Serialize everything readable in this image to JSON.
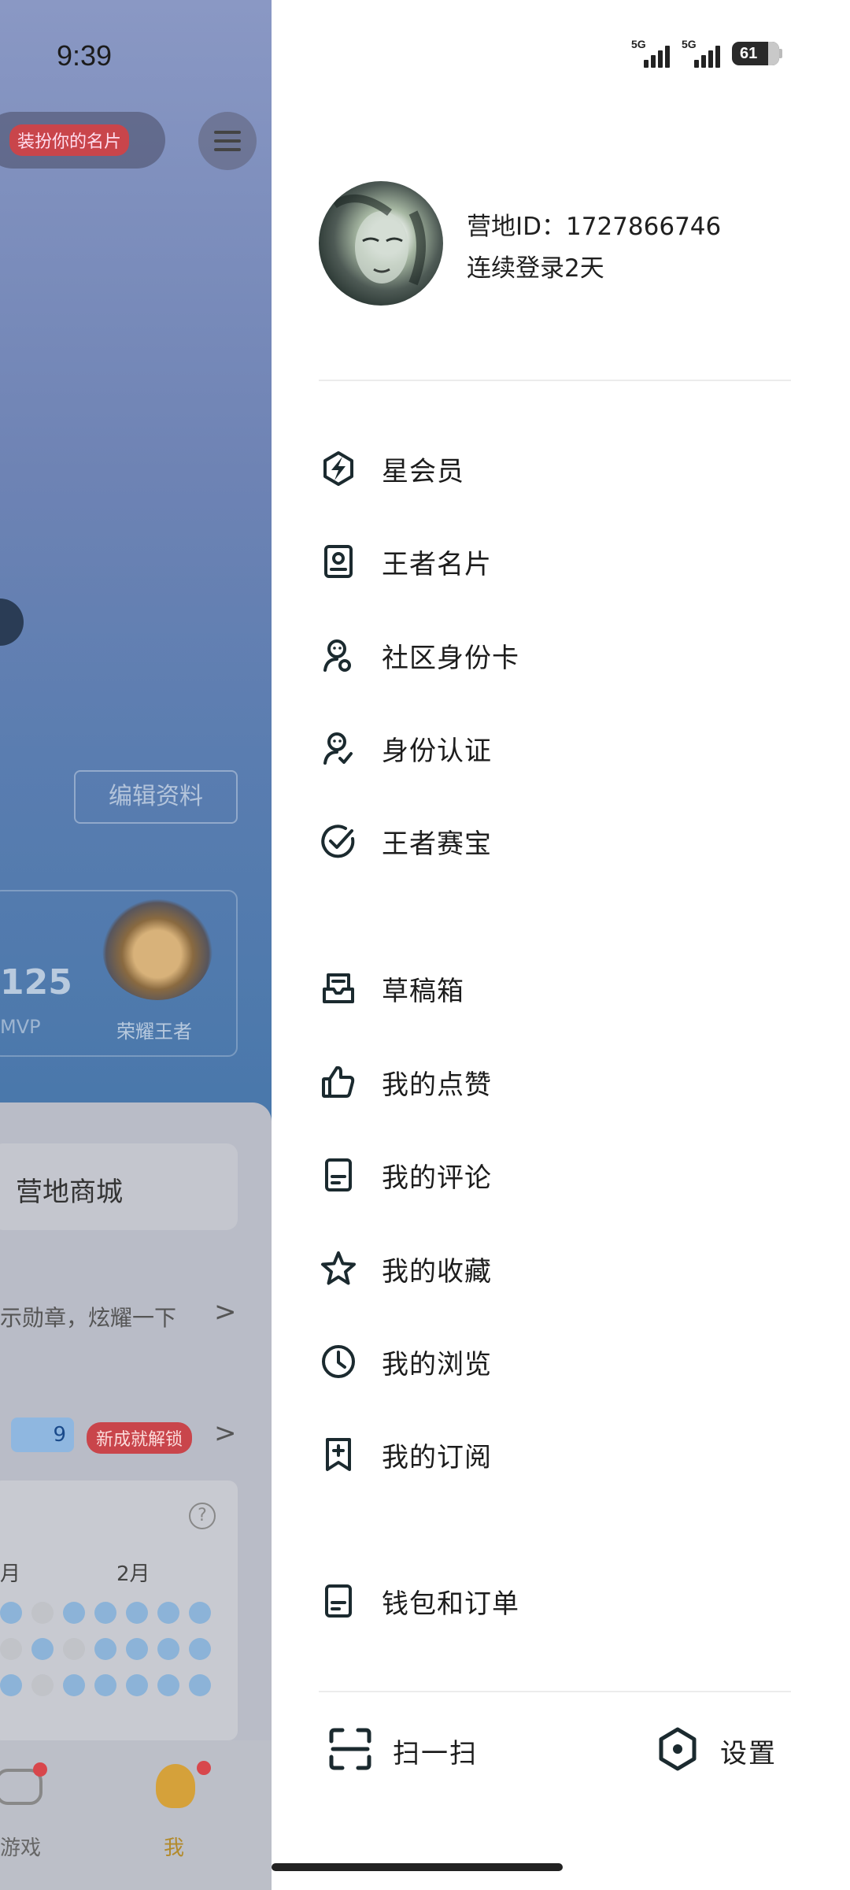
{
  "background": {
    "status_time": "9:39",
    "dress_up_badge": "装扮你的名片",
    "edit_profile_button": "编辑资料",
    "stat_number": "125",
    "stat_label": "MVP",
    "rank_label": "荣耀王者",
    "shop_label": "营地商城",
    "medal_hint": "示勋章，炫耀一下",
    "badge_level": "9",
    "unlock_badge": "新成就解锁",
    "month_a": "月",
    "month_b": "2月",
    "help_glyph": "?",
    "nav_games": "游戏",
    "nav_me": "我"
  },
  "status_bar": {
    "sim1_label": "5G",
    "sim2_label": "5G",
    "battery": "61"
  },
  "profile": {
    "camp_id": "营地ID：1727866746",
    "login_streak": "连续登录2天"
  },
  "menu": {
    "star_member": "星会员",
    "king_card": "王者名片",
    "community_id_card": "社区身份卡",
    "identity_verify": "身份认证",
    "king_treasure": "王者赛宝",
    "drafts": "草稿箱",
    "my_likes": "我的点赞",
    "my_comments": "我的评论",
    "my_favorites": "我的收藏",
    "my_history": "我的浏览",
    "my_subscriptions": "我的订阅",
    "wallet_orders": "钱包和订单"
  },
  "footer": {
    "scan_label": "扫一扫",
    "settings_label": "设置"
  }
}
